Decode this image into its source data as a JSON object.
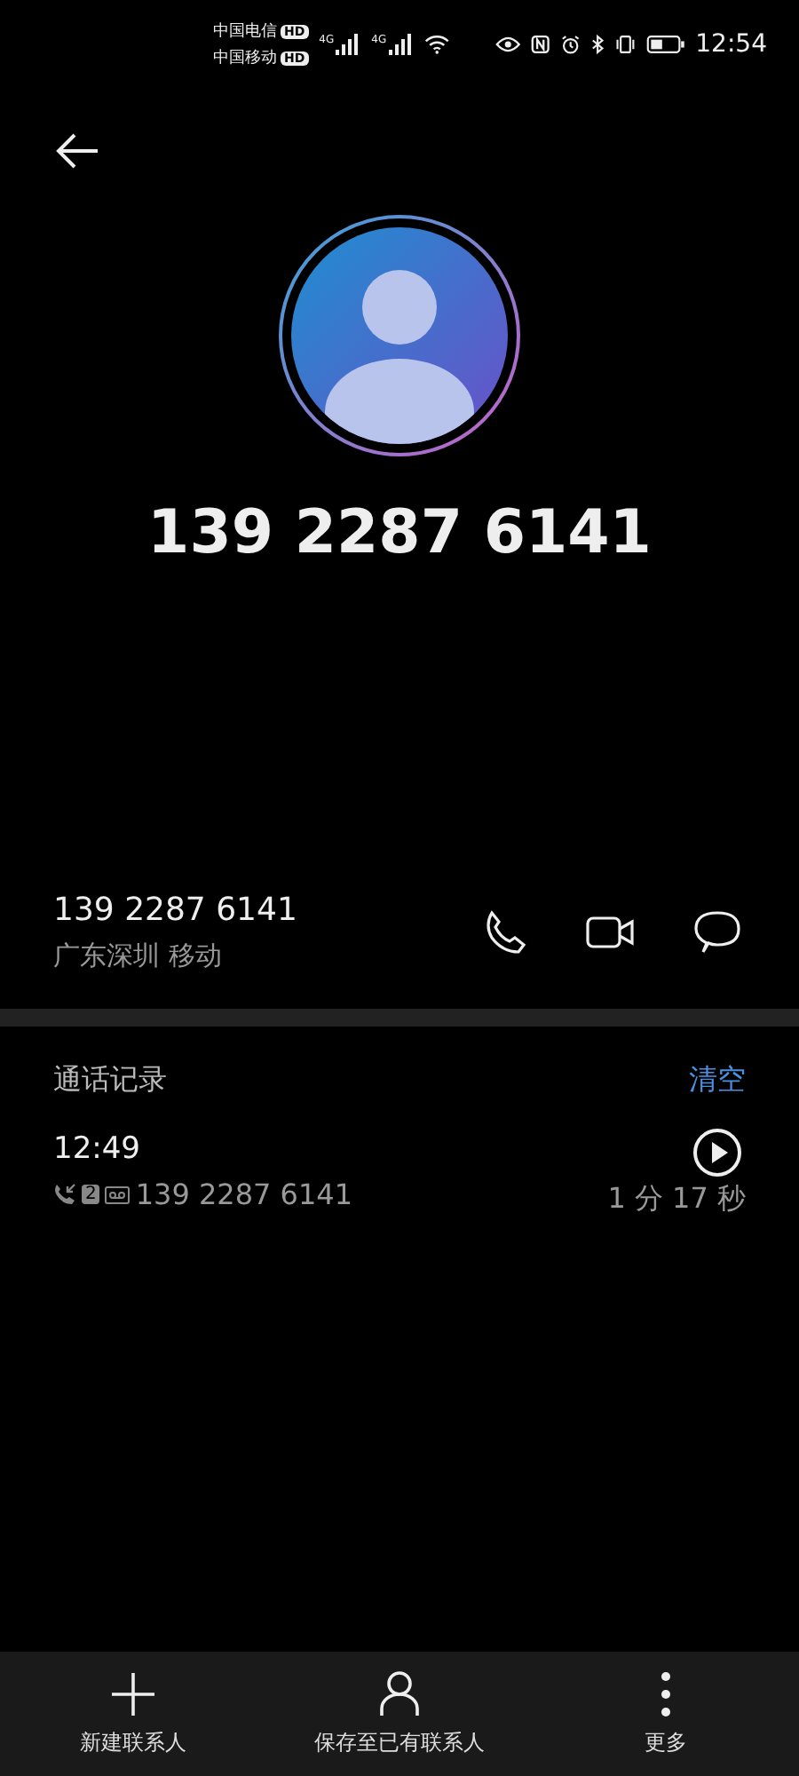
{
  "status_bar": {
    "carriers": [
      {
        "name": "中国电信",
        "badge": "HD"
      },
      {
        "name": "中国移动",
        "badge": "HD"
      }
    ],
    "networks": [
      "4G",
      "4G"
    ],
    "time": "12:54"
  },
  "contact": {
    "name": "139 2287 6141"
  },
  "number": {
    "value": "139 2287 6141",
    "location": "广东深圳 移动"
  },
  "call_log": {
    "title": "通话记录",
    "clear": "清空",
    "entries": [
      {
        "time": "12:49",
        "sim": "2",
        "number": "139 2287 6141",
        "duration": "1 分 17 秒"
      }
    ]
  },
  "actions": [
    {
      "kind": "add",
      "label": "新建联系人"
    },
    {
      "kind": "person",
      "label": "保存至已有联系人"
    },
    {
      "kind": "more",
      "label": "更多"
    }
  ]
}
